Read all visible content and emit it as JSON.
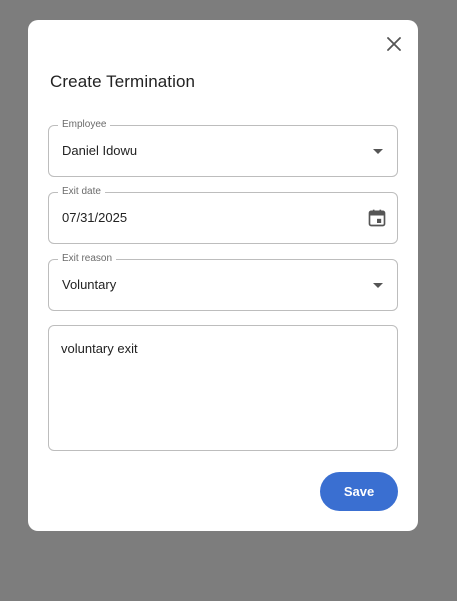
{
  "dialog": {
    "title": "Create Termination",
    "close_icon": "close-icon"
  },
  "form": {
    "employee": {
      "label": "Employee",
      "value": "Daniel Idowu",
      "icon": "chevron-down-icon"
    },
    "exit_date": {
      "label": "Exit date",
      "value": "07/31/2025",
      "icon": "calendar-icon"
    },
    "exit_reason": {
      "label": "Exit reason",
      "value": "Voluntary",
      "icon": "chevron-down-icon"
    },
    "notes": {
      "value": "voluntary exit"
    }
  },
  "actions": {
    "save_label": "Save"
  },
  "colors": {
    "backdrop": "#7d7d7d",
    "accent": "#3a6fd1",
    "border": "#bdbdbd"
  }
}
